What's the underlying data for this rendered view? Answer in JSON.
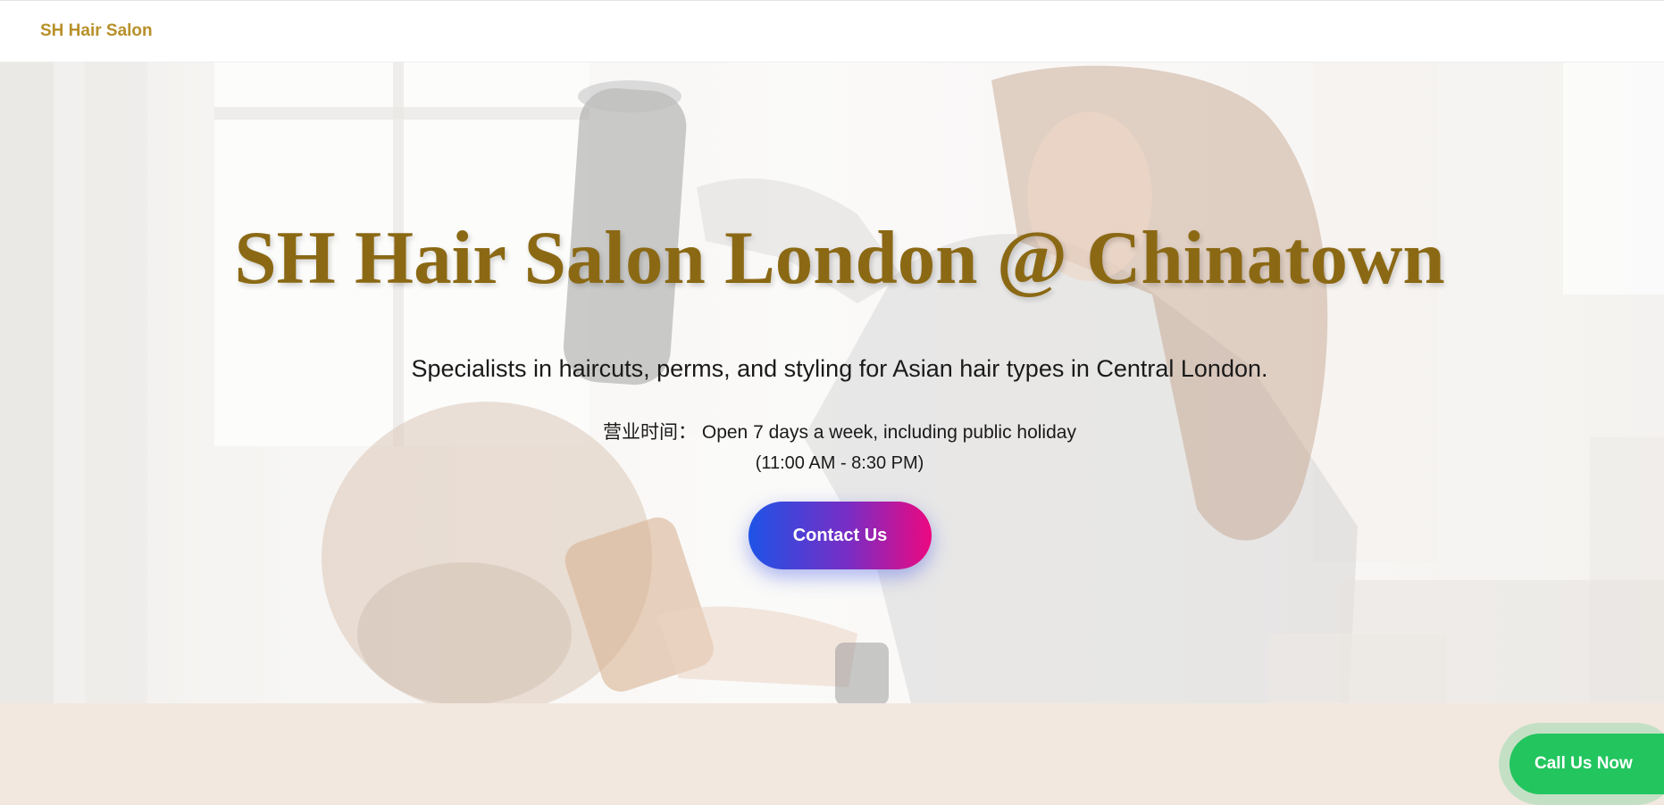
{
  "navbar": {
    "brand": "SH Hair Salon"
  },
  "hero": {
    "title": "SH Hair Salon London @ Chinatown",
    "subtitle": "Specialists in haircuts, perms, and styling for Asian hair types in Central London.",
    "hours_label": "营业时间：",
    "hours_text": "Open 7 days a week, including public holiday",
    "hours_range": "(11:00 AM - 8:30 PM)",
    "contact_label": "Contact Us"
  },
  "floating": {
    "call_label": "Call Us Now"
  },
  "colors": {
    "brand_gold": "#b8902a",
    "title_gold": "#8b6914",
    "cta_gradient_start": "#1e53e6",
    "cta_gradient_end": "#ec087f",
    "call_green": "#22c55e",
    "section_bg": "#f2e8e0"
  }
}
